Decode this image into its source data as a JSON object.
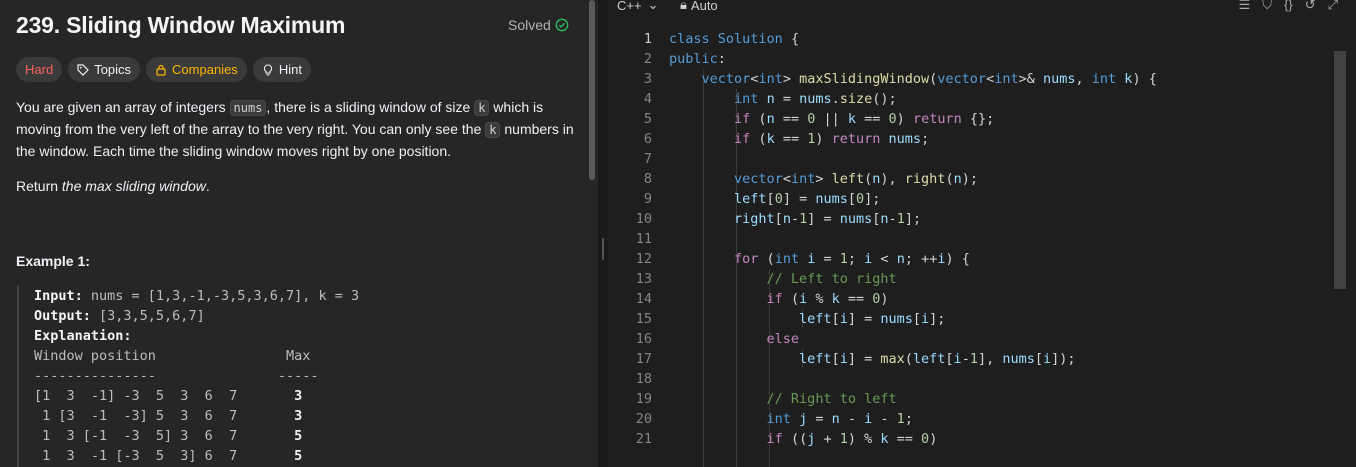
{
  "problem": {
    "title": "239. Sliding Window Maximum",
    "solved_label": "Solved",
    "tags": {
      "difficulty": "Hard",
      "topics": "Topics",
      "companies": "Companies",
      "hint": "Hint"
    },
    "description": {
      "p1": "You are given an array of integers ",
      "c1": "nums",
      "p2": ", there is a sliding window of size ",
      "c2": "k",
      "p3": " which is moving from the very left of the array to the very right. You can only see the ",
      "c3": "k",
      "p4": " numbers in the window. Each time the sliding window moves right by one position."
    },
    "return_prefix": "Return ",
    "return_italic": "the max sliding window",
    "return_suffix": ".",
    "example_title": "Example 1:",
    "example": {
      "input_label": "Input:",
      "input_value": " nums = [1,3,-1,-3,5,3,6,7], k = 3",
      "output_label": "Output:",
      "output_value": " [3,3,5,5,6,7]",
      "explanation_label": "Explanation:",
      "header": "Window position                Max",
      "rule": "---------------               -----",
      "rows": [
        {
          "window": "[1  3  -1] -3  5  3  6  7       ",
          "max": "3"
        },
        {
          "window": " 1 [3  -1  -3] 5  3  6  7       ",
          "max": "3"
        },
        {
          "window": " 1  3 [-1  -3  5] 3  6  7       ",
          "max": "5"
        },
        {
          "window": " 1  3  -1 [-3  5  3] 6  7       ",
          "max": "5"
        }
      ]
    }
  },
  "editor": {
    "language": "C++",
    "mode": "Auto",
    "line_numbers": [
      "1",
      "2",
      "3",
      "4",
      "5",
      "6",
      "7",
      "8",
      "9",
      "10",
      "11",
      "12",
      "13",
      "14",
      "15",
      "16",
      "17",
      "18",
      "19",
      "20",
      "21"
    ]
  }
}
